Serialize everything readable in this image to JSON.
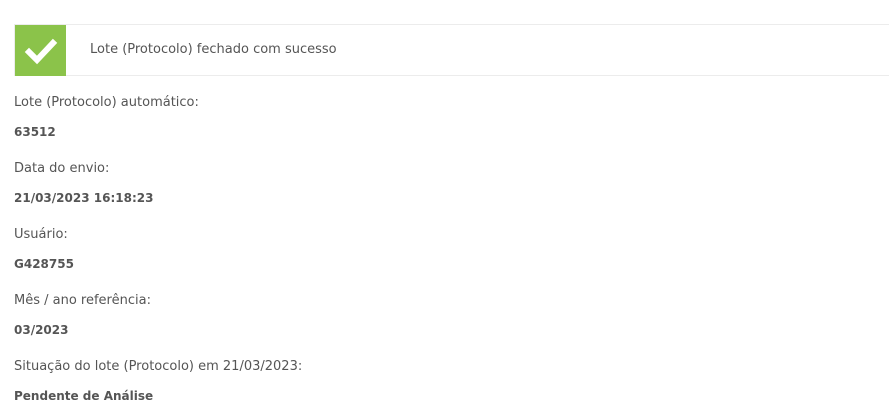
{
  "alert": {
    "icon": "check-icon",
    "message": "Lote (Protocolo) fechado com sucesso",
    "color": "#8bc34a"
  },
  "fields": [
    {
      "label": "Lote (Protocolo) automático:",
      "value": "63512"
    },
    {
      "label": "Data do envio:",
      "value": "21/03/2023 16:18:23"
    },
    {
      "label": "Usuário:",
      "value": "G428755"
    },
    {
      "label": "Mês / ano referência:",
      "value": "03/2023"
    },
    {
      "label": "Situação do lote (Protocolo) em 21/03/2023:",
      "value": "Pendente de Análise"
    }
  ]
}
